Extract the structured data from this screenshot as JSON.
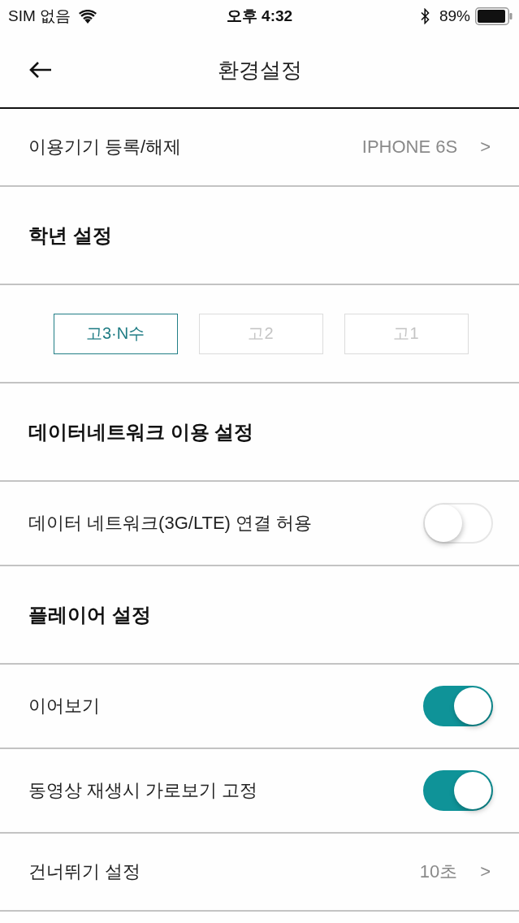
{
  "status_bar": {
    "carrier": "SIM 없음",
    "time": "오후 4:32",
    "battery": "89%"
  },
  "nav": {
    "title": "환경설정"
  },
  "rows": [
    {
      "kind": "link",
      "label": "이용기기 등록/해제",
      "value": "IPHONE 6S",
      "chevron": ">"
    },
    {
      "kind": "header",
      "label": "학년 설정"
    },
    {
      "kind": "options",
      "options": [
        {
          "label": "고3·N수",
          "selected": true
        },
        {
          "label": "고2",
          "selected": false
        },
        {
          "label": "고1",
          "selected": false
        }
      ]
    },
    {
      "kind": "header",
      "label": "데이터네트워크 이용 설정"
    },
    {
      "kind": "toggle",
      "label": "데이터 네트워크(3G/LTE) 연결 허용",
      "on": false
    },
    {
      "kind": "header",
      "label": "플레이어 설정"
    },
    {
      "kind": "toggle",
      "label": "이어보기",
      "on": true
    },
    {
      "kind": "toggle",
      "label": "동영상 재생시 가로보기 고정",
      "on": true
    },
    {
      "kind": "link",
      "label": "건너뛰기 설정",
      "value": "10초",
      "chevron": ">"
    }
  ]
}
